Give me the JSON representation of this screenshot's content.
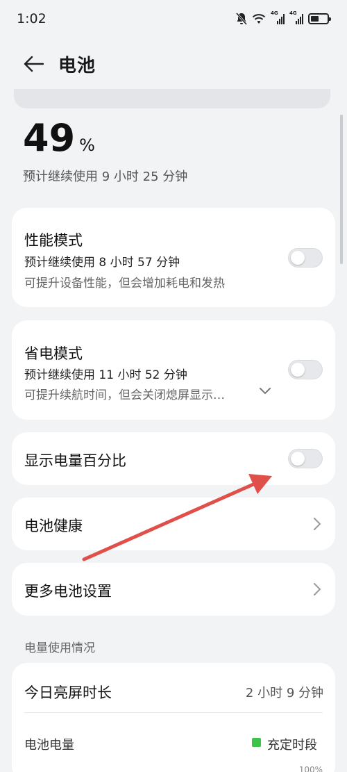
{
  "status_bar": {
    "time": "1:02",
    "battery_level": 0.49
  },
  "header": {
    "title": "电池"
  },
  "battery": {
    "percent": "49",
    "unit": "%",
    "estimate": "预计继续使用 9 小时 25 分钟"
  },
  "performance_mode": {
    "title": "性能模式",
    "estimate": "预计继续使用 8 小时 57 分钟",
    "description": "可提升设备性能，但会增加耗电和发热",
    "enabled": false
  },
  "power_saving_mode": {
    "title": "省电模式",
    "estimate": "预计继续使用 11 小时 52 分钟",
    "description": "可提升续航时间，但会关闭熄屏显示…",
    "enabled": false
  },
  "show_percentage": {
    "title": "显示电量百分比",
    "enabled": false
  },
  "battery_health": {
    "title": "电池健康"
  },
  "more_settings": {
    "title": "更多电池设置"
  },
  "usage_section": {
    "label": "电量使用情况",
    "screen_time_label": "今日亮屏时长",
    "screen_time_value": "2 小时 9 分钟",
    "battery_level_label": "电池电量",
    "legend_label": "充定时段",
    "axis_top": "100%",
    "legend_color": "#3ec34a"
  },
  "colors": {
    "annotation_arrow": "#e0504a",
    "background": "#f1f3f5"
  }
}
